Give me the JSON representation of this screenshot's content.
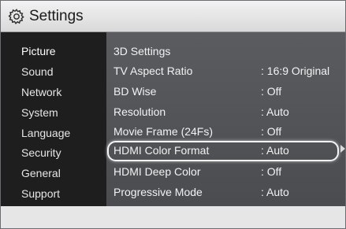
{
  "header": {
    "title": "Settings",
    "icon": "gear-icon"
  },
  "sidebar": {
    "items": [
      {
        "label": "Picture",
        "active": true
      },
      {
        "label": "Sound"
      },
      {
        "label": "Network"
      },
      {
        "label": "System"
      },
      {
        "label": "Language"
      },
      {
        "label": "Security"
      },
      {
        "label": "General"
      },
      {
        "label": "Support"
      }
    ]
  },
  "settings": {
    "rows": [
      {
        "label": "3D Settings",
        "value": ""
      },
      {
        "label": "TV Aspect Ratio",
        "value": ": 16:9 Original"
      },
      {
        "label": "BD Wise",
        "value": ": Off"
      },
      {
        "label": "Resolution",
        "value": ": Auto"
      },
      {
        "label": "Movie Frame (24Fs)",
        "value": ": Off"
      },
      {
        "label": "HDMI Color Format",
        "value": ": Auto",
        "selected": true
      },
      {
        "label": "HDMI Deep Color",
        "value": ": Off"
      },
      {
        "label": "Progressive Mode",
        "value": ": Auto"
      }
    ]
  },
  "colors": {
    "sidebar_bg": "#1e1e1e",
    "content_bg": "#55575b",
    "titlebar_bg": "#e4e4e4",
    "highlight": "#f4f4f4"
  }
}
